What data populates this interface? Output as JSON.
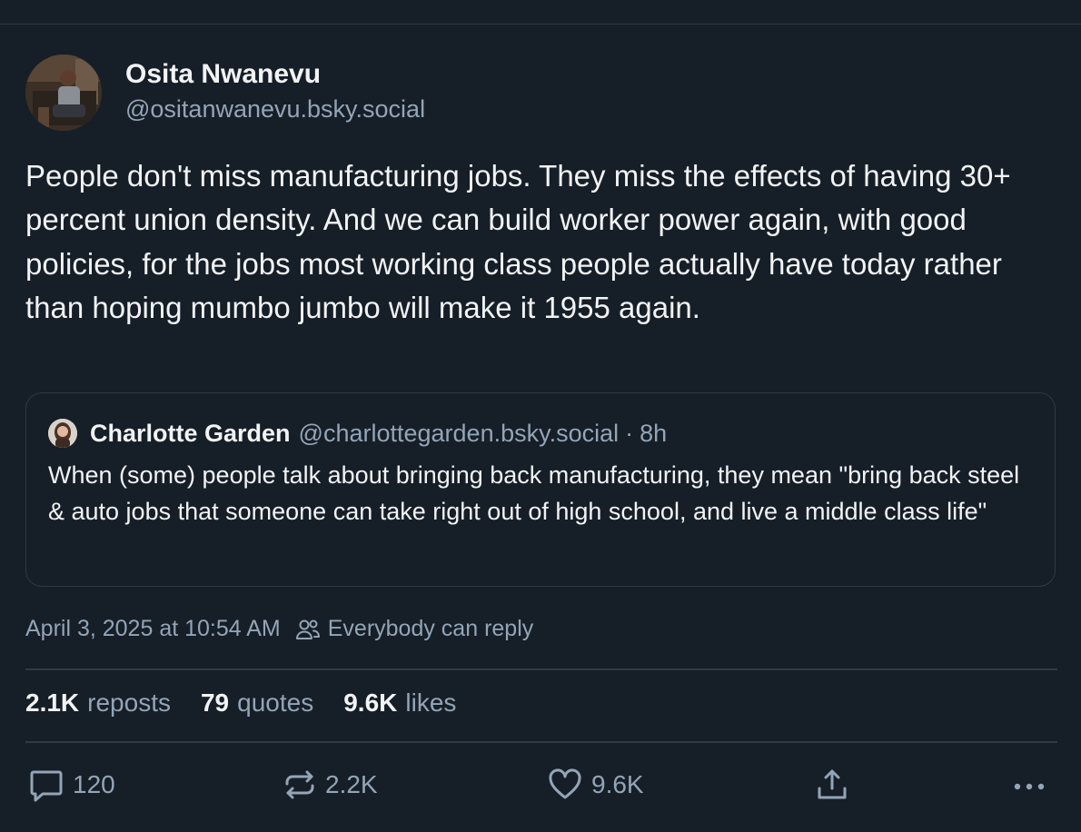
{
  "post": {
    "author": {
      "display_name": "Osita Nwanevu",
      "handle": "@ositanwanevu.bsky.social"
    },
    "text": "People don't miss manufacturing jobs. They miss the effects of having 30+ percent union density. And we can build worker power again, with good policies, for the jobs most working class people actually have today rather than hoping mumbo jumbo will make it 1955 again.",
    "quote": {
      "author_name": "Charlotte Garden",
      "author_handle": "@charlottegarden.bsky.social",
      "separator": "·",
      "time": "8h",
      "text": "When (some) people talk about bringing back manufacturing, they mean \"bring back steel & auto jobs that someone can take right out of high school, and live a middle class life\""
    },
    "timestamp": "April 3, 2025 at 10:54 AM",
    "reply_setting": "Everybody can reply",
    "stats": {
      "reposts_count": "2.1K",
      "reposts_label": "reposts",
      "quotes_count": "79",
      "quotes_label": "quotes",
      "likes_count": "9.6K",
      "likes_label": "likes"
    },
    "actions": {
      "reply_count": "120",
      "repost_count": "2.2K",
      "like_count": "9.6K",
      "reply_icon": "speech-bubble-icon",
      "repost_icon": "repost-arrows-icon",
      "like_icon": "heart-icon",
      "share_icon": "share-icon",
      "more_icon": "ellipsis-icon"
    }
  },
  "colors": {
    "background": "#161e27",
    "text_primary": "#f1f3f5",
    "text_secondary": "#93a5b7",
    "border": "#2e3a47"
  }
}
